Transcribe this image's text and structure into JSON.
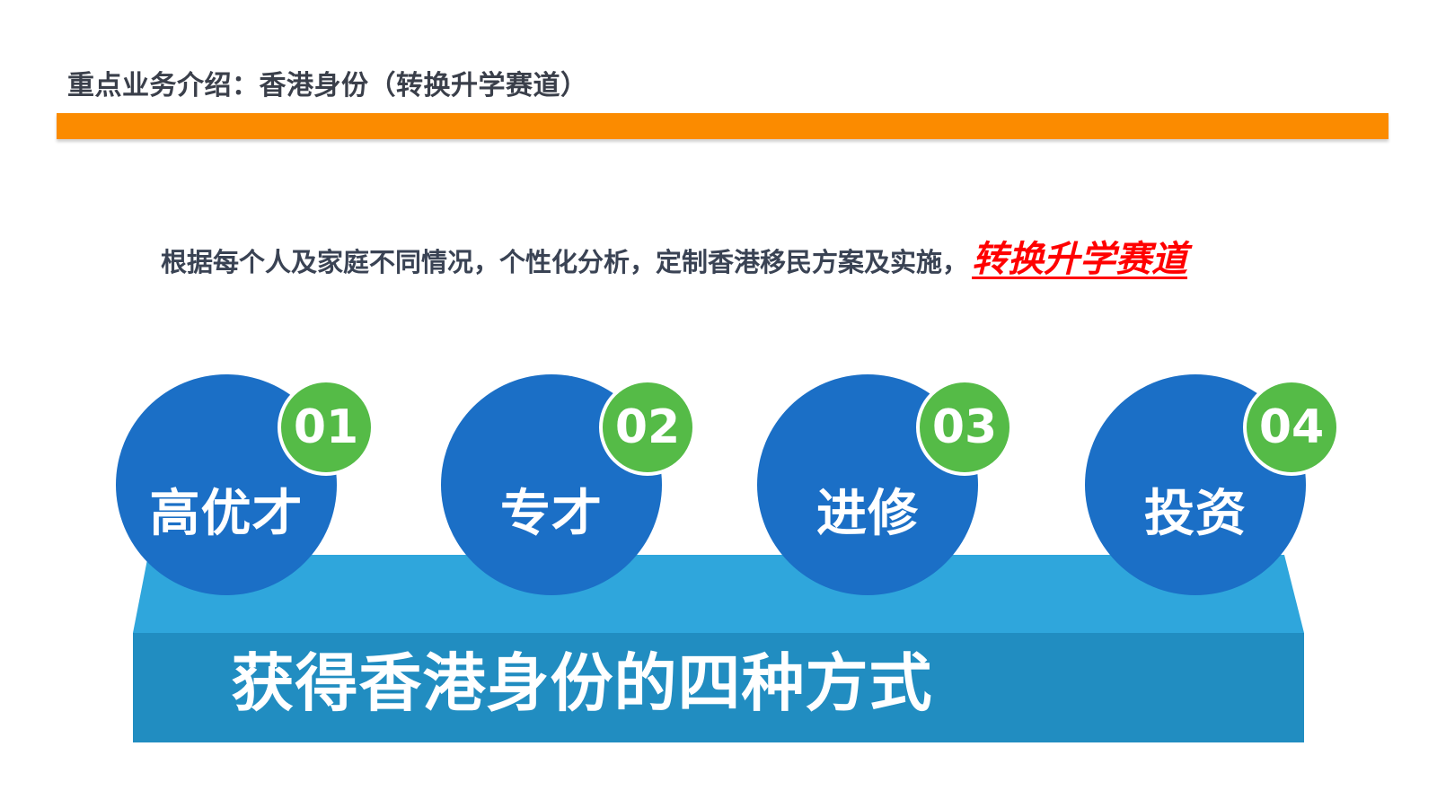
{
  "slide": {
    "title": "重点业务介绍：香港身份（转换升学赛道）",
    "subtitle": "根据每个人及家庭不同情况，个性化分析，定制香港移民方案及实施，",
    "subtitle_highlight": "转换升学赛道"
  },
  "ways": [
    {
      "number": "01",
      "label": "高优才"
    },
    {
      "number": "02",
      "label": "专才"
    },
    {
      "number": "03",
      "label": "进修"
    },
    {
      "number": "04",
      "label": "投资"
    }
  ],
  "base": {
    "label": "获得香港身份的四种方式"
  },
  "colors": {
    "accent_bar": "#fb8b00",
    "circle": "#1b6fc6",
    "badge": "#55bb47",
    "platform_top": "#2fa6dc",
    "platform_front": "#218dc1",
    "highlight": "#ff0000"
  }
}
